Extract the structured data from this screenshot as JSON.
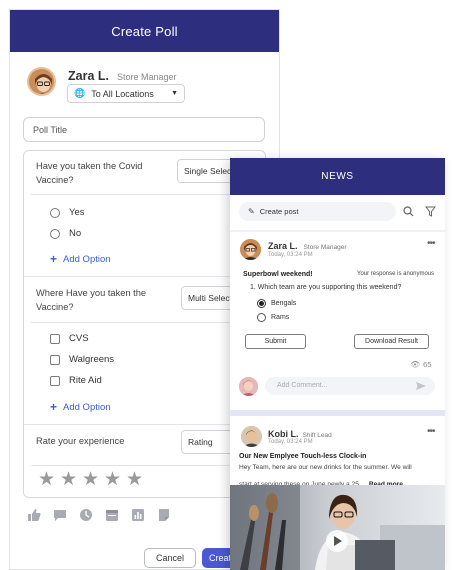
{
  "create_poll": {
    "title": "Create Poll",
    "user": {
      "name": "Zara L.",
      "role": "Store Manager"
    },
    "audience": {
      "selected": "To All Locations"
    },
    "poll_title_placeholder": "Poll Title",
    "questions": [
      {
        "text_line1": "Have you taken the Covid",
        "text_line2": "Vaccine?",
        "type": "Single Select",
        "options": [
          "Yes",
          "No"
        ],
        "add_option_label": "Add Option"
      },
      {
        "text_line1": "Where Have you taken the",
        "text_line2": "Vaccine?",
        "type": "Multi Select",
        "options": [
          "CVS",
          "Walgreens",
          "Rite Aid"
        ],
        "add_option_label": "Add Option"
      },
      {
        "text_line1": "Rate your experience",
        "type": "Rating",
        "stars": 5
      }
    ],
    "toolbar_icons": [
      "thumbs-up-icon",
      "comment-icon",
      "clock-icon",
      "calendar-icon",
      "chart-icon",
      "document-icon"
    ],
    "cancel_label": "Cancel",
    "create_label": "Create"
  },
  "news": {
    "title": "NEWS",
    "create_post_label": "Create post",
    "post1": {
      "author": "Zara L.",
      "role": "Store Manager",
      "time": "Today, 03:24 PM",
      "heading": "Superbowl weekend!",
      "anon_note": "Your response is anonymous",
      "question": "1. Which team are you supporting this weekend?",
      "options": [
        "Bengals",
        "Rams"
      ],
      "selected_index": 0,
      "submit_label": "Submit",
      "download_label": "Download Result",
      "views": "65",
      "comment_placeholder": "Add Comment..."
    },
    "post2": {
      "author": "Kobi L.",
      "role": "Shift Lead",
      "time": "Today, 03:24 PM",
      "headline": "Our New Emplyee Touch-less Clock-in",
      "body_line1": "Hey Team, here are our new drinks for the summer. We will",
      "body_line2": "start at serving these on June newly a 25...",
      "read_more": "Read more"
    }
  }
}
